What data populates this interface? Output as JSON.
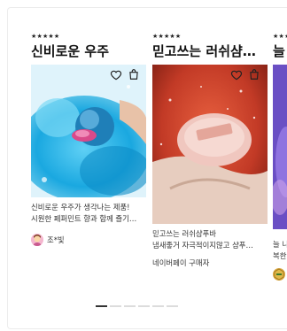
{
  "cards": [
    {
      "stars": "★★★★★",
      "title": "신비로운 우주",
      "desc_line1": "신비로운 우주가 생각나는 제품!",
      "desc_line2": "시원한 페퍼민트 향과 함께 즐기…",
      "reviewer": "조*빛",
      "wishlist_icon": "heart-icon",
      "cart_icon": "shopping-bag-icon"
    },
    {
      "stars": "★★★★★",
      "title": "믿고쓰는 러쉬샴…",
      "desc_line1": "믿고쓰는 러쉬샴푸바",
      "desc_line2": "냄새좋거 자극적이지않고 샴푸…",
      "reviewer": "네이버페이 구매자",
      "wishlist_icon": "heart-icon",
      "cart_icon": "shopping-bag-icon"
    },
    {
      "stars": "★★★",
      "title": "늘",
      "desc_line1": "늘 나",
      "desc_line2": "복한",
      "reviewer": ""
    }
  ],
  "pager": {
    "count": 6,
    "active_index": 0
  }
}
